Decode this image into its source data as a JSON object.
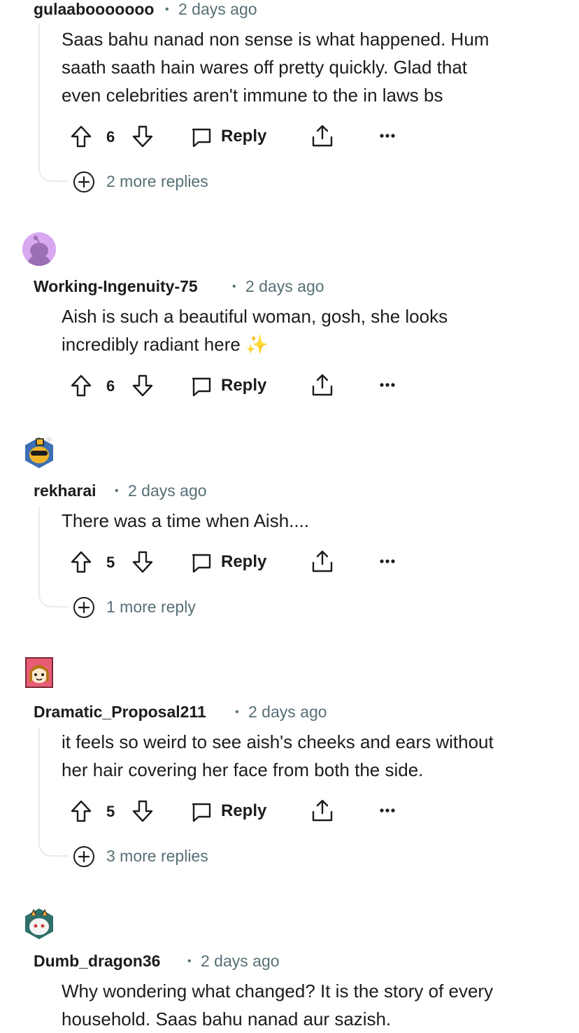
{
  "comments": [
    {
      "username": "gulaabooooooo",
      "time": "2 days ago",
      "lines": [
        "Saas bahu nanad non sense is what happened. Hum",
        "saath saath hain wares off pretty quickly. Glad that",
        "even celebrities aren't immune to the in laws bs"
      ],
      "votes": "6",
      "reply_label": "Reply",
      "more_replies": "2 more replies"
    },
    {
      "username": "Working-Ingenuity-75",
      "time": "2 days ago",
      "lines": [
        "Aish is such a beautiful woman, gosh, she looks",
        "incredibly radiant here"
      ],
      "emoji": "✨",
      "votes": "6",
      "reply_label": "Reply"
    },
    {
      "username": "rekharai",
      "time": "2 days ago",
      "lines": [
        "There was a time when Aish...."
      ],
      "votes": "5",
      "reply_label": "Reply",
      "more_replies": "1 more reply"
    },
    {
      "username": "Dramatic_Proposal211",
      "time": "2 days ago",
      "lines": [
        "it feels so weird to see aish's cheeks and ears without",
        "her hair covering her face from both the side."
      ],
      "votes": "5",
      "reply_label": "Reply",
      "more_replies": "3 more replies"
    },
    {
      "username": "Dumb_dragon36",
      "time": "2 days ago",
      "lines": [
        "Why wondering what changed? It is the story of every",
        "household. Saas bahu nanad aur sazish."
      ]
    }
  ],
  "separator": "•",
  "icons": [
    "upvote-icon",
    "downvote-icon",
    "comment-bubble-icon",
    "share-icon",
    "more-options-icon",
    "expand-plus-icon"
  ],
  "colors": {
    "text": "#1c1c1c",
    "meta": "#576f76",
    "thread": "#e5ebee"
  }
}
